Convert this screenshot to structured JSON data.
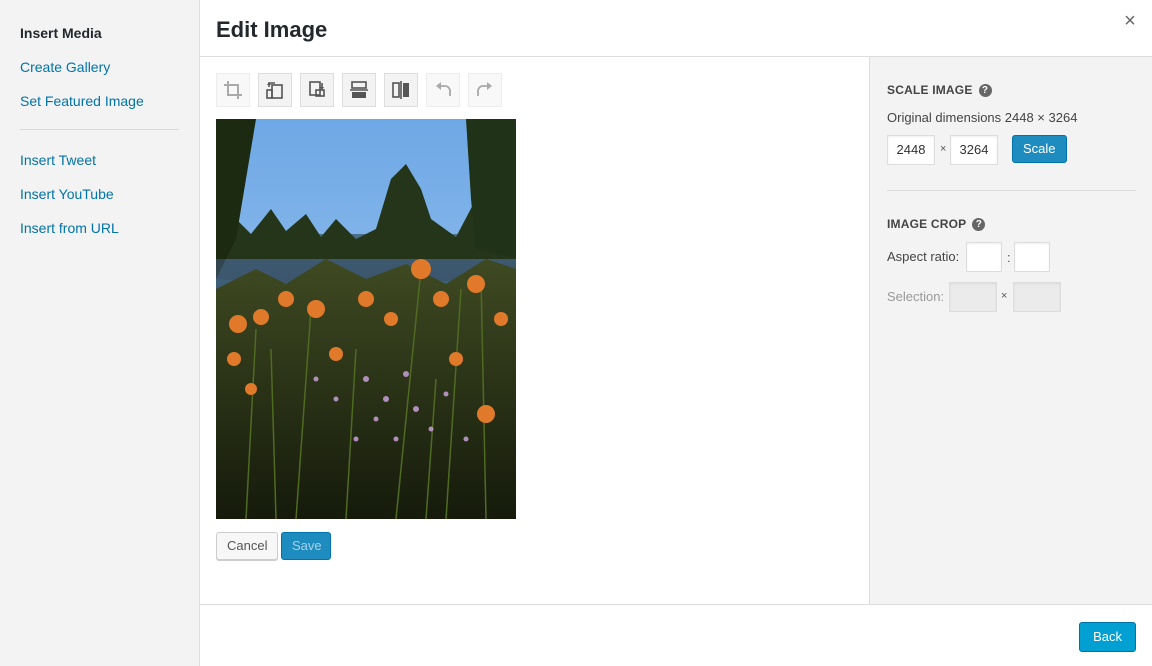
{
  "menu": {
    "items": [
      {
        "label": "Insert Media",
        "active": true
      },
      {
        "label": "Create Gallery"
      },
      {
        "label": "Set Featured Image"
      },
      {
        "label": "Insert Tweet"
      },
      {
        "label": "Insert YouTube"
      },
      {
        "label": "Insert from URL"
      }
    ]
  },
  "header": {
    "title": "Edit Image",
    "close_glyph": "×"
  },
  "toolbar": {
    "tools": [
      {
        "icon": "crop-icon",
        "enabled": false
      },
      {
        "icon": "rotate-left-icon",
        "enabled": true
      },
      {
        "icon": "rotate-right-icon",
        "enabled": true
      },
      {
        "icon": "flip-vertical-icon",
        "enabled": true
      },
      {
        "icon": "flip-horizontal-icon",
        "enabled": true
      },
      {
        "icon": "undo-icon",
        "enabled": false
      },
      {
        "icon": "redo-icon",
        "enabled": false
      }
    ]
  },
  "image": {
    "subject": "lake with orange daylilies in foreground"
  },
  "actions": {
    "cancel_label": "Cancel",
    "save_label": "Save"
  },
  "scale": {
    "title": "SCALE IMAGE",
    "help_glyph": "?",
    "original_dimensions": "Original dimensions 2448 × 3264",
    "width": "2448",
    "height": "3264",
    "times": "×",
    "button_label": "Scale"
  },
  "crop": {
    "title": "IMAGE CROP",
    "help_glyph": "?",
    "aspect_label": "Aspect ratio:",
    "aspect_sep": ":",
    "aspect_w": "",
    "aspect_h": "",
    "selection_label": "Selection:",
    "times": "×",
    "selection_w": "",
    "selection_h": ""
  },
  "footer": {
    "back_label": "Back"
  },
  "colors": {
    "accent": "#0073aa",
    "primary_button": "#00a0d2",
    "panel_bg": "#f3f3f3"
  }
}
